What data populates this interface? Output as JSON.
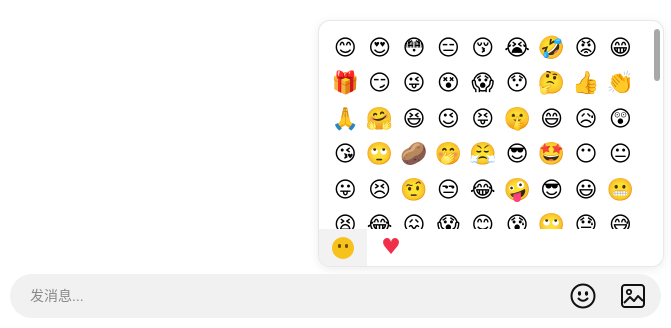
{
  "emoji_panel": {
    "emojis": [
      "😊",
      "😍",
      "😳",
      "😑",
      "😚",
      "😭",
      "🤣",
      "😡",
      "😁",
      "🎁",
      "😏",
      "😜",
      "😵",
      "😱",
      "😯",
      "🤔",
      "👍",
      "👏",
      "🙏",
      "🤗",
      "😆",
      "😉",
      "😝",
      "🤫",
      "😄",
      "😥",
      "😲",
      "😘",
      "🙄",
      "🥔",
      "🤭",
      "😤",
      "😎",
      "🤩",
      "😶",
      "😐",
      "😛",
      "😣",
      "🤨",
      "😒",
      "😂",
      "🤪",
      "😎",
      "😃",
      "😬",
      "😫",
      "😂",
      "😖",
      "😱",
      "😊",
      "😰",
      "🙄",
      "😓",
      "😅"
    ],
    "tabs": [
      {
        "icon": "face-icon",
        "active": true
      },
      {
        "icon": "heart-icon",
        "active": false
      }
    ],
    "heart_glyph": "♥",
    "accent": "#f0304a",
    "face_color": "#f8c21c"
  },
  "input_bar": {
    "placeholder": "发消息..."
  }
}
